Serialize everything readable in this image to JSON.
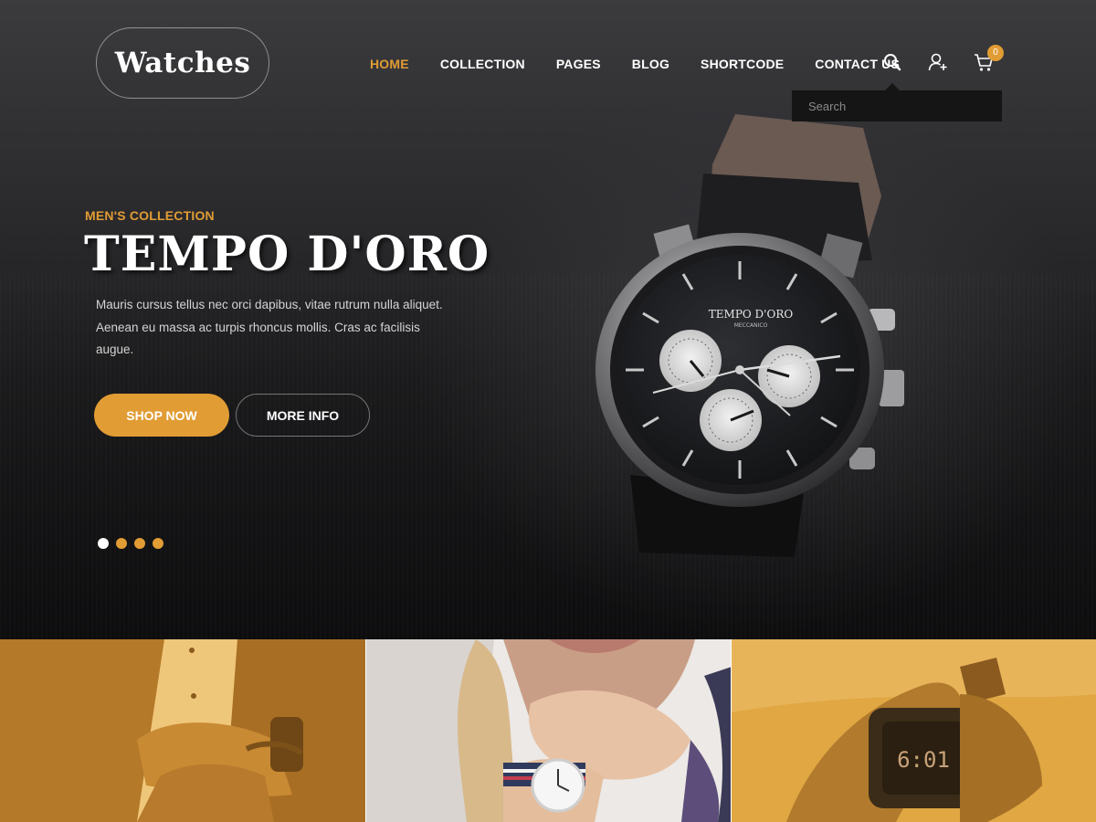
{
  "brand": {
    "logo_text": "Watches"
  },
  "nav": {
    "items": [
      {
        "label": "HOME",
        "active": true
      },
      {
        "label": "COLLECTION",
        "active": false
      },
      {
        "label": "PAGES",
        "active": false
      },
      {
        "label": "BLOG",
        "active": false
      },
      {
        "label": "SHORTCODE",
        "active": false
      },
      {
        "label": "CONTACT US",
        "active": false
      }
    ]
  },
  "header_icons": {
    "search": "search-icon",
    "account": "user-plus-icon",
    "cart": "cart-icon",
    "cart_count": "0"
  },
  "search": {
    "placeholder": "Search",
    "value": ""
  },
  "hero": {
    "eyebrow": "MEN'S COLLECTION",
    "title": "TEMPO D'ORO",
    "description": "Mauris cursus tellus nec orci dapibus, vitae rutrum nulla aliquet. Aenean eu massa ac turpis rhoncus mollis. Cras ac facilisis augue.",
    "primary_button": "SHOP NOW",
    "secondary_button": "MORE INFO",
    "slider": {
      "total": 4,
      "active_index": 0
    },
    "watch_dial_text": "TEMPO D'ORO",
    "watch_dial_subtext": "MECCANICO"
  },
  "tiles": [
    {
      "name": "suit-cufflink-tile"
    },
    {
      "name": "woman-wristwatch-tile"
    },
    {
      "name": "digital-watch-tile",
      "display": "6:01"
    }
  ],
  "colors": {
    "accent": "#e19c34",
    "hero_dark": "#1f1f21",
    "tile_overlay": "#e0a743"
  }
}
